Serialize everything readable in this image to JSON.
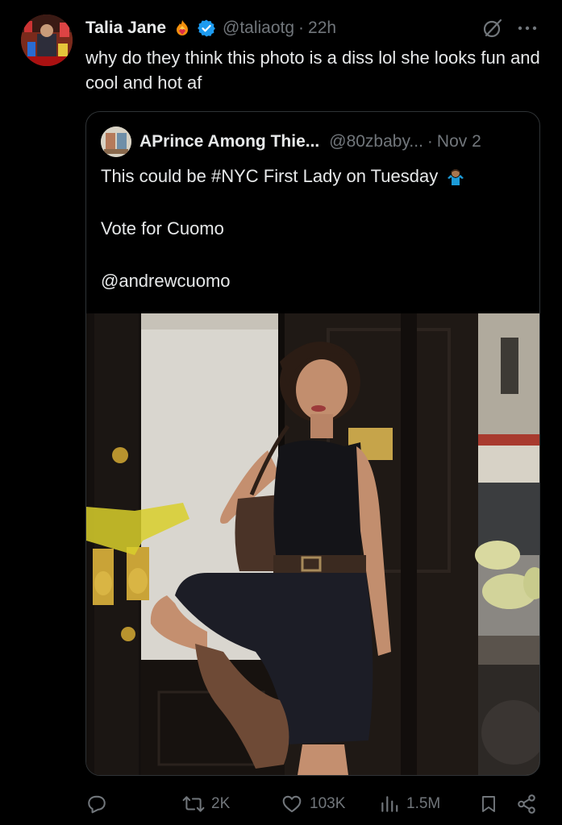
{
  "tweet": {
    "author_name": "Talia Jane",
    "author_handle": "@taliaotg",
    "separator": "·",
    "time": "22h",
    "text": "why do they think this photo is a diss lol she looks fun and cool and hot af"
  },
  "quoted_tweet": {
    "author_name": "APrince Among Thie...",
    "author_handle": "@80zbaby...",
    "separator": "·",
    "date": "Nov 2",
    "lines": [
      "This could be #NYC First Lady on Tuesday",
      "Vote for Cuomo",
      "@andrewcuomo"
    ]
  },
  "actions": {
    "reply_count": "",
    "repost_count": "2K",
    "like_count": "103K",
    "views_count": "1.5M"
  },
  "icons": {
    "emoji": "fire-heart-emoji",
    "verified": "verified-badge-icon",
    "grok": "grok-icon",
    "more": "more-icon",
    "reply": "reply-icon",
    "repost": "repost-icon",
    "like": "heart-icon",
    "views": "views-icon",
    "bookmark": "bookmark-icon",
    "share": "share-icon",
    "shrug": "shrug-emoji"
  },
  "colors": {
    "background": "#000000",
    "text": "#e7e9ea",
    "muted": "#71767b",
    "verified": "#1d9bf0",
    "border": "#2f3336"
  }
}
